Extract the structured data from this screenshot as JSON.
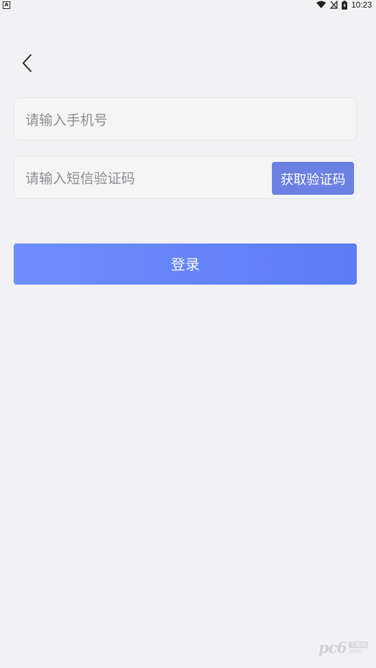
{
  "status_bar": {
    "notification_letter": "A",
    "time": "10:23"
  },
  "form": {
    "phone_placeholder": "请输入手机号",
    "code_placeholder": "请输入短信验证码",
    "get_code_label": "获取验证码",
    "login_label": "登录"
  },
  "watermark": {
    "logo": "pc6",
    "tag": "下载站",
    "url": ".com"
  },
  "colors": {
    "background": "#f2f2f4",
    "accent": "#6b80e3",
    "login_gradient_start": "#6f8dfb",
    "login_gradient_end": "#5c7cf5"
  },
  "icons": {
    "back": "chevron-left-icon",
    "wifi": "wifi-icon",
    "signal": "no-signal-icon",
    "battery": "battery-charging-icon"
  }
}
